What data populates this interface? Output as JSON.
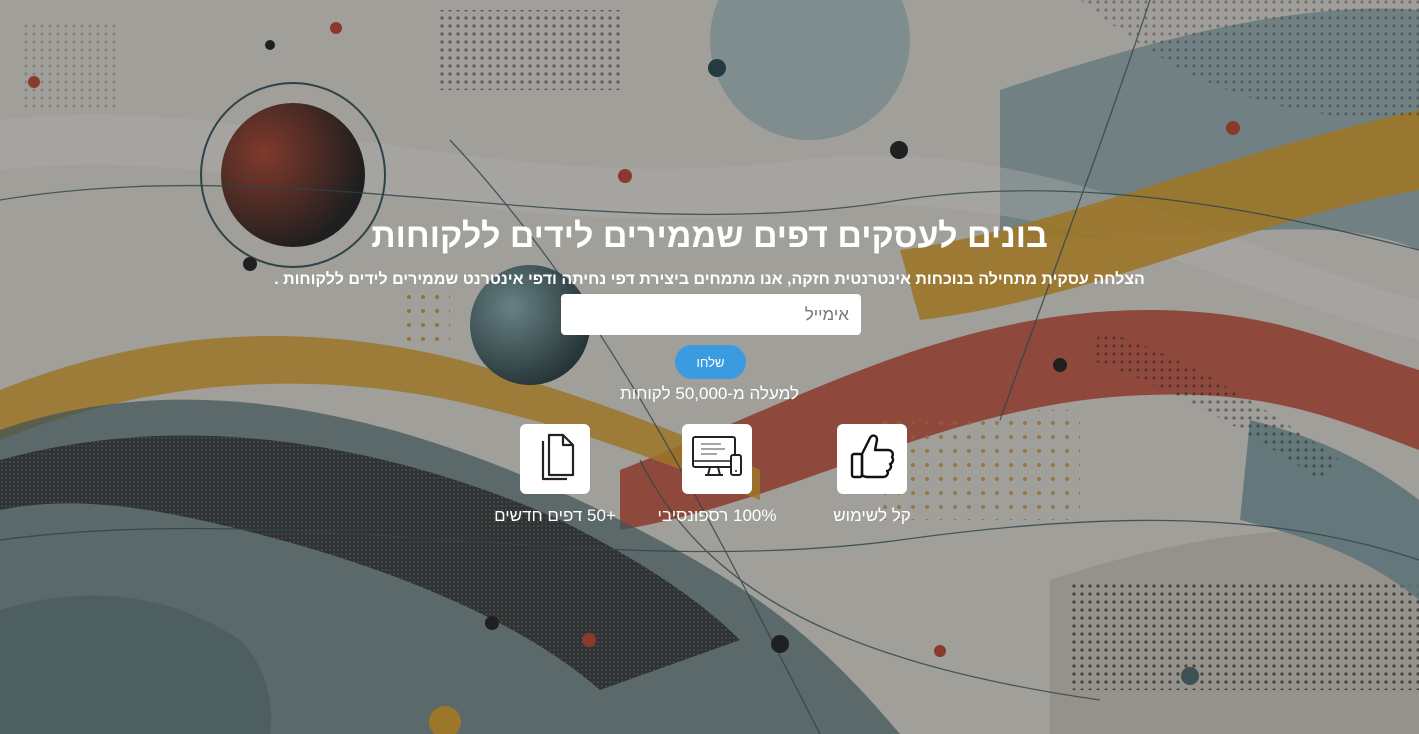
{
  "hero": {
    "title": "בונים לעסקים דפים שממירים לידים ללקוחות",
    "subtitle": "הצלחה עסקית מתחילה בנוכחות אינטרנטית חזקה, אנו מתמחים ביצירת דפי נחיתה ודפי אינטרנט שממירים לידים ללקוחות .",
    "email_placeholder": "אימייל",
    "email_value": "",
    "send_label": "שלחו",
    "customers_text": "למעלה מ-50,000 לקוחות"
  },
  "features": [
    {
      "icon": "thumbs-up-icon",
      "label": "קל לשימוש"
    },
    {
      "icon": "responsive-devices-icon",
      "label": "100% רספונסיבי"
    },
    {
      "icon": "documents-icon",
      "label": "+50 דפים חדשים"
    }
  ],
  "colors": {
    "accent": "#3a9be0",
    "wave_red": "#c8452f",
    "wave_yellow": "#e4a62a",
    "wave_teal": "#5d8e98",
    "background": "#ece8e0"
  }
}
